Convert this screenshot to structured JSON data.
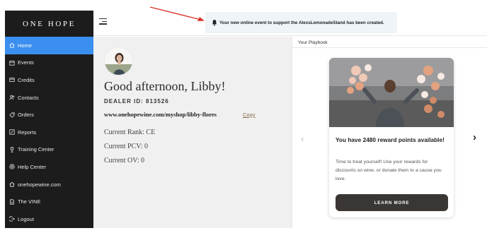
{
  "brand": {
    "logo": "ONE HOPE"
  },
  "sidebar": {
    "items": [
      {
        "label": "Home",
        "icon": "home-icon",
        "active": true
      },
      {
        "label": "Events",
        "icon": "calendar-icon"
      },
      {
        "label": "Credits",
        "icon": "credit-card-icon"
      },
      {
        "label": "Contacts",
        "icon": "contacts-icon"
      },
      {
        "label": "Orders",
        "icon": "tag-icon"
      },
      {
        "label": "Reports",
        "icon": "reports-icon"
      },
      {
        "label": "Training Center",
        "icon": "trophy-icon"
      },
      {
        "label": "Help Center",
        "icon": "help-icon"
      },
      {
        "label": "onehopewine.com",
        "icon": "home-icon"
      },
      {
        "label": "The VINE",
        "icon": "document-icon"
      },
      {
        "label": "Logout",
        "icon": "logout-icon"
      }
    ]
  },
  "notification": {
    "text": "Your new online event to support the AlexsLemonadeStand has been created."
  },
  "dashboard": {
    "greeting": "Good afternoon, Libby!",
    "dealer_id": "DEALER ID: 813526",
    "shop_url": "www.onehopewine.com/myshop/libby-flores",
    "copy_label": "Copy",
    "rank": "Current Rank: CE",
    "pcv": "Current PCV: 0",
    "ov": "Current OV: 0"
  },
  "playbook": {
    "title": "Your Playbook",
    "card": {
      "heading": "You have 2480 reward points available!",
      "body": "Time to treat yourself! Use your rewards for discounts on wine, or donate them to a cause you love.",
      "button": "LEARN MORE"
    }
  },
  "colors": {
    "sidebar_bg": "#1c1c1c",
    "active": "#3b8ff0",
    "notice_bg": "#eef4f8",
    "button": "#3a3633",
    "annotation_arrow": "#d9342b"
  }
}
